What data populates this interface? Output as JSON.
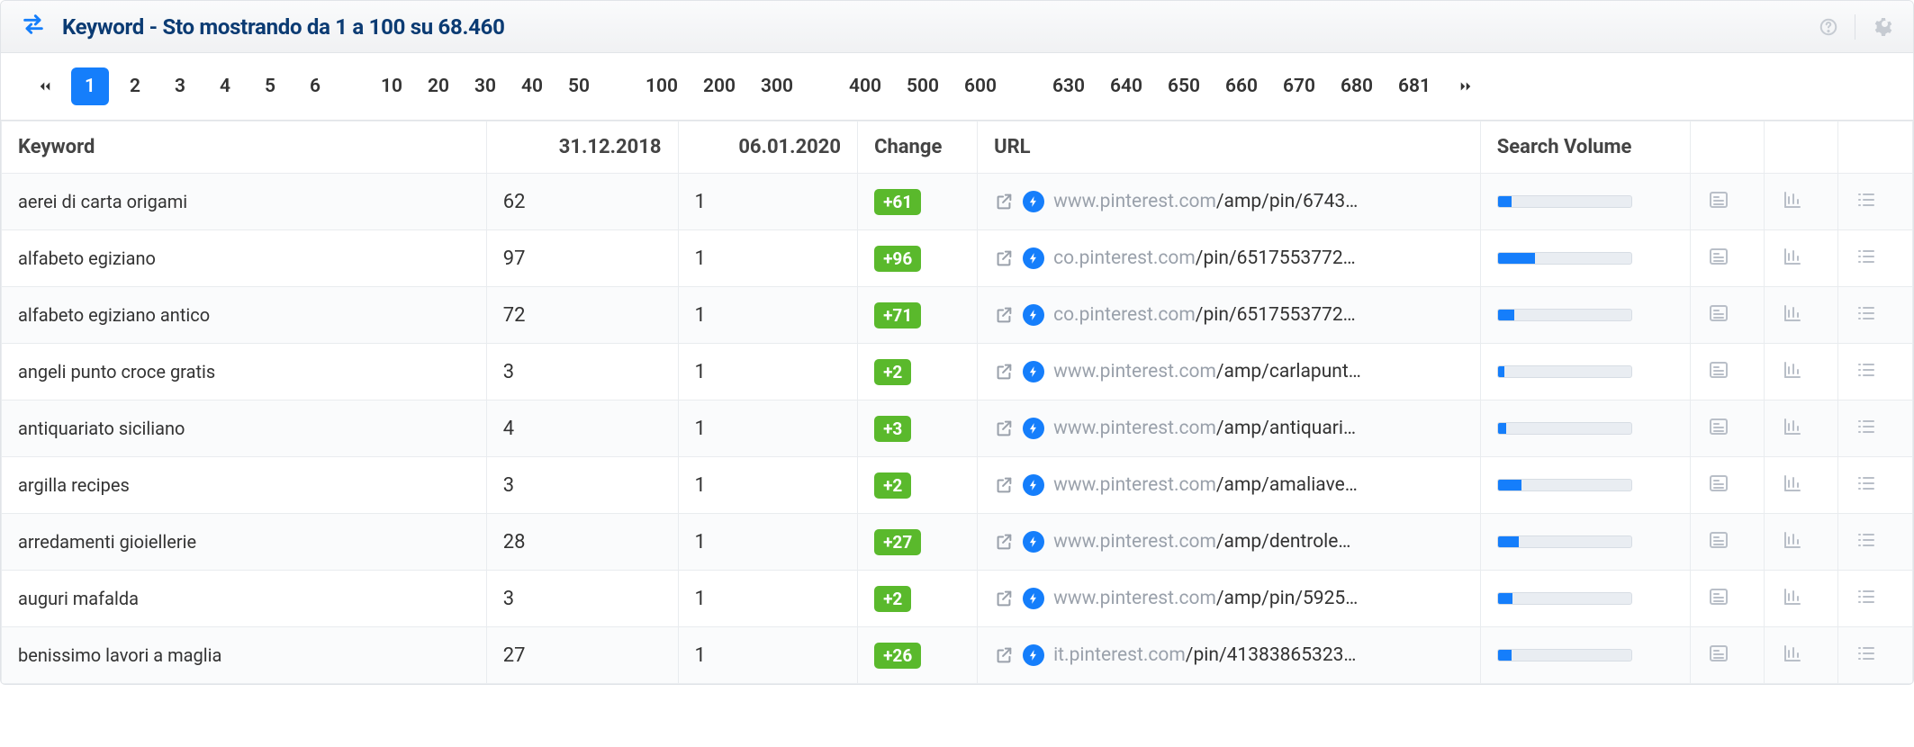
{
  "header": {
    "title": "Keyword - Sto mostrando da 1 a 100 su 68.460"
  },
  "pagination": {
    "pages": [
      "1",
      "2",
      "3",
      "4",
      "5",
      "6",
      "10",
      "20",
      "30",
      "40",
      "50",
      "100",
      "200",
      "300",
      "400",
      "500",
      "600",
      "630",
      "640",
      "650",
      "660",
      "670",
      "680",
      "681"
    ],
    "active": "1"
  },
  "columns": {
    "keyword": "Keyword",
    "date1": "31.12.2018",
    "date2": "06.01.2020",
    "change": "Change",
    "url": "URL",
    "volume": "Search Volume"
  },
  "rows": [
    {
      "keyword": "aerei di carta origami",
      "d1": "62",
      "d2": "1",
      "change": "+61",
      "url_dom": "www.pinterest.com",
      "url_path": "/amp/pin/6743…",
      "volume_pct": 10
    },
    {
      "keyword": "alfabeto egiziano",
      "d1": "97",
      "d2": "1",
      "change": "+96",
      "url_dom": "co.pinterest.com",
      "url_path": "/pin/6517553772…",
      "volume_pct": 28
    },
    {
      "keyword": "alfabeto egiziano antico",
      "d1": "72",
      "d2": "1",
      "change": "+71",
      "url_dom": "co.pinterest.com",
      "url_path": "/pin/6517553772…",
      "volume_pct": 12
    },
    {
      "keyword": "angeli punto croce gratis",
      "d1": "3",
      "d2": "1",
      "change": "+2",
      "url_dom": "www.pinterest.com",
      "url_path": "/amp/carlapunt…",
      "volume_pct": 5
    },
    {
      "keyword": "antiquariato siciliano",
      "d1": "4",
      "d2": "1",
      "change": "+3",
      "url_dom": "www.pinterest.com",
      "url_path": "/amp/antiquari…",
      "volume_pct": 6
    },
    {
      "keyword": "argilla recipes",
      "d1": "3",
      "d2": "1",
      "change": "+2",
      "url_dom": "www.pinterest.com",
      "url_path": "/amp/amaliave…",
      "volume_pct": 18
    },
    {
      "keyword": "arredamenti gioiellerie",
      "d1": "28",
      "d2": "1",
      "change": "+27",
      "url_dom": "www.pinterest.com",
      "url_path": "/amp/dentrole…",
      "volume_pct": 16
    },
    {
      "keyword": "auguri mafalda",
      "d1": "3",
      "d2": "1",
      "change": "+2",
      "url_dom": "www.pinterest.com",
      "url_path": "/amp/pin/5925…",
      "volume_pct": 11
    },
    {
      "keyword": "benissimo lavori a maglia",
      "d1": "27",
      "d2": "1",
      "change": "+26",
      "url_dom": "it.pinterest.com",
      "url_path": "/pin/41383865323…",
      "volume_pct": 10
    }
  ]
}
